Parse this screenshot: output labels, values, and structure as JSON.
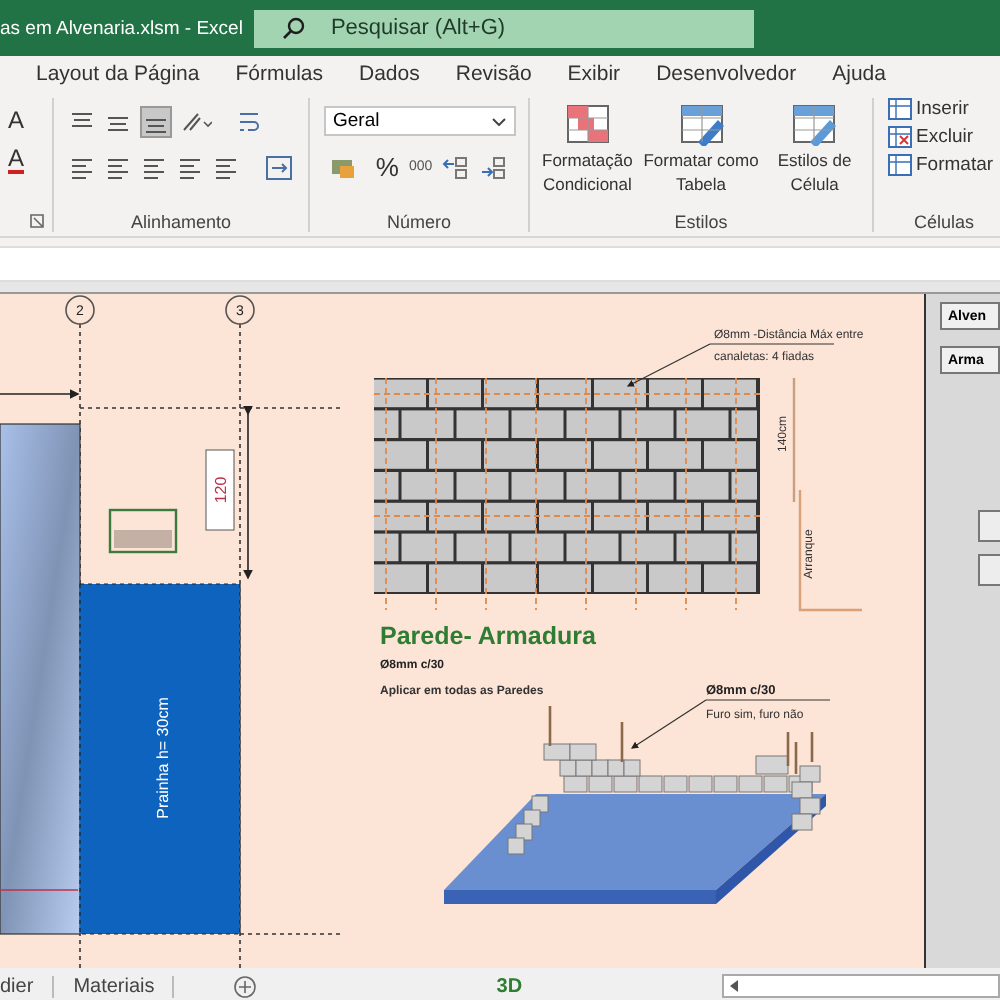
{
  "window": {
    "title": "as em Alvenaria.xlsm  -  Excel"
  },
  "search": {
    "placeholder": "Pesquisar (Alt+G)"
  },
  "tabs": [
    {
      "label": "Layout da Página",
      "selected": false
    },
    {
      "label": "Fórmulas",
      "selected": false
    },
    {
      "label": "Dados",
      "selected": false
    },
    {
      "label": "Revisão",
      "selected": false
    },
    {
      "label": "Exibir",
      "selected": false
    },
    {
      "label": "Desenvolvedor",
      "selected": false
    },
    {
      "label": "Ajuda",
      "selected": false
    }
  ],
  "ribbon": {
    "font_glyphs": [
      "A",
      "A"
    ],
    "alignment_label": "Alinhamento",
    "number_format": "Geral",
    "percent": "%",
    "thousands": "000",
    "number_label": "Número",
    "styles": [
      {
        "lines": [
          "Formatação",
          "Condicional"
        ]
      },
      {
        "lines": [
          "Formatar como",
          "Tabela"
        ]
      },
      {
        "lines": [
          "Estilos de",
          "Célula"
        ]
      }
    ],
    "styles_label": "Estilos",
    "cells": [
      {
        "label": "Inserir"
      },
      {
        "label": "Excluir"
      },
      {
        "label": "Formatar"
      }
    ],
    "cells_label": "Células"
  },
  "sheet": {
    "grid_markers": [
      "2",
      "3"
    ],
    "dimension": "120",
    "slab_label": "Prainha h= 30cm",
    "wall_note": [
      "Ø8mm -Distância Máx entre",
      "canaletas: 4 fiadas"
    ],
    "wall_height": "140cm",
    "starter": "Arranque",
    "title": "Parede- Armadura",
    "spec": "Ø8mm c/30",
    "apply_note": "Aplicar em todas as Paredes",
    "detail_spec": "Ø8mm c/30",
    "detail_note": "Furo sim, furo não"
  },
  "side_buttons": [
    "Alven",
    "Arma"
  ],
  "sheet_tabs": [
    "dier",
    "Materiais"
  ],
  "caption": "3D"
}
